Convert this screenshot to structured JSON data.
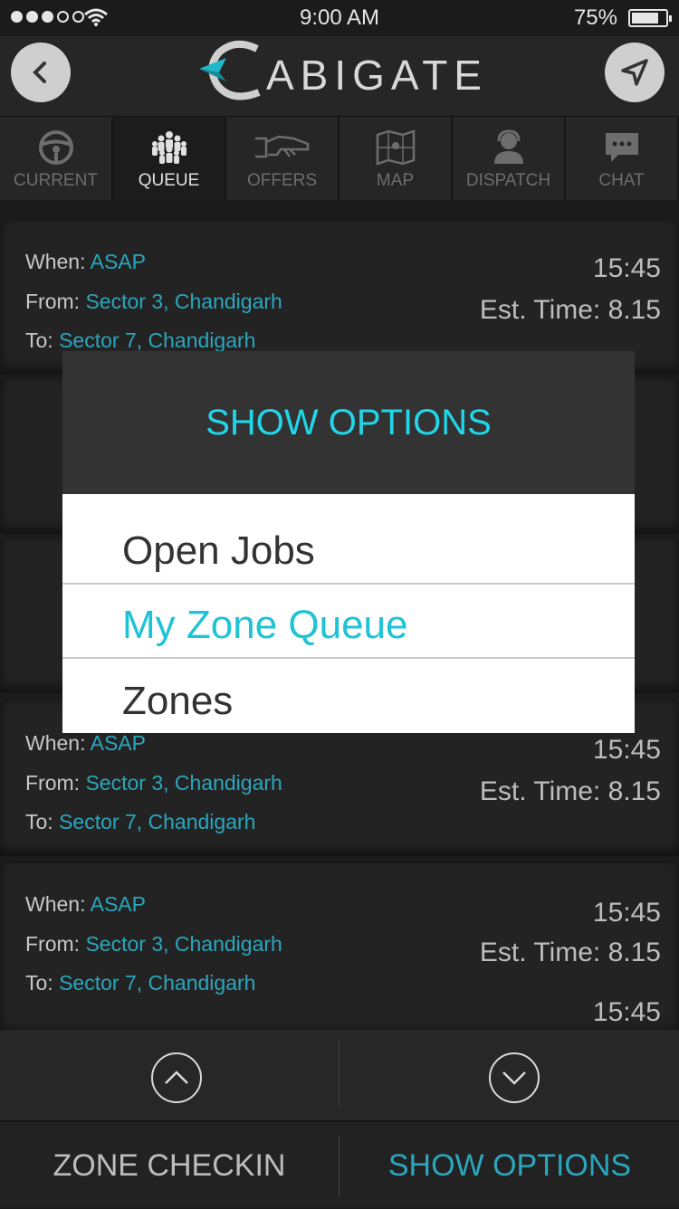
{
  "status_bar": {
    "time": "9:00 AM",
    "battery": "75%"
  },
  "header": {
    "logo_initial": "C",
    "logo_rest": "ABIGATE"
  },
  "tabs": [
    {
      "label": "CURRENT",
      "icon": "steering-wheel-icon"
    },
    {
      "label": "QUEUE",
      "icon": "people-queue-icon",
      "active": true
    },
    {
      "label": "OFFERS",
      "icon": "handshake-icon"
    },
    {
      "label": "MAP",
      "icon": "map-icon"
    },
    {
      "label": "DISPATCH",
      "icon": "operator-headset-icon"
    },
    {
      "label": "CHAT",
      "icon": "chat-bubble-icon"
    }
  ],
  "job_labels": {
    "when": "When: ",
    "from": "From: ",
    "to": "To: "
  },
  "jobs": [
    {
      "when": "ASAP",
      "from": "Sector 3, Chandigarh",
      "to": "Sector 7, Chandigarh",
      "time": "15:45",
      "est": "Est. Time: 8.15"
    },
    {
      "when": "ASAP",
      "from": "Sector 3, Chandigarh",
      "to": "Sector 7, Chandigarh",
      "time": "15:45",
      "est": "Est. Time: 8.15"
    },
    {
      "when": "ASAP",
      "from": "Sector 3, Chandigarh",
      "to": "Sector 7, Chandigarh",
      "time": "15:45",
      "est": "Est. Time: 8.15"
    }
  ],
  "partial_time": "15:45",
  "modal": {
    "title": "SHOW OPTIONS",
    "options": [
      "Open Jobs",
      "My Zone Queue",
      "Zones"
    ],
    "selected": "My Zone Queue"
  },
  "bottom_bar": {
    "left": "ZONE CHECKIN",
    "right": "SHOW OPTIONS"
  },
  "colors": {
    "accent": "#2ba6bd",
    "modal_title": "#20d6e8"
  }
}
